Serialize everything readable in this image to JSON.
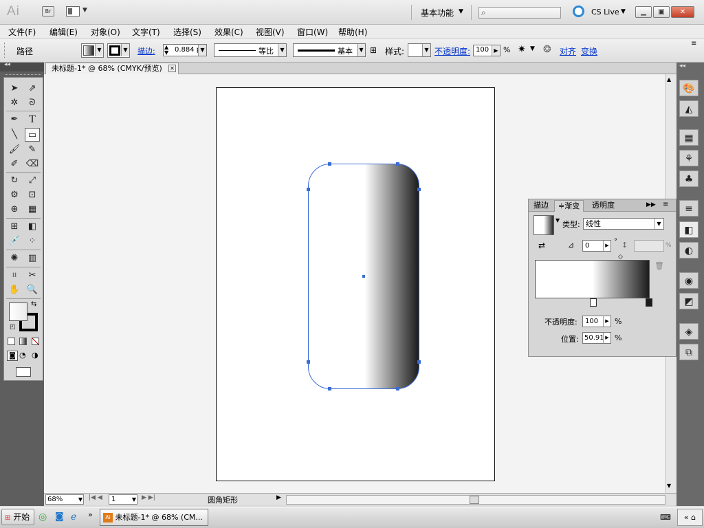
{
  "app": {
    "logo": "Ai",
    "bridge_label": "Br",
    "workspace_label": "基本功能",
    "cs_live_label": "CS Live"
  },
  "window_controls": {
    "minimize": "▁",
    "restore": "▣",
    "close": "✕"
  },
  "menu": [
    "文件(F)",
    "编辑(E)",
    "对象(O)",
    "文字(T)",
    "选择(S)",
    "效果(C)",
    "视图(V)",
    "窗口(W)",
    "帮助(H)"
  ],
  "control_bar": {
    "selection_type": "路径",
    "stroke_link": "描边:",
    "stroke_weight": "0.884 p",
    "profile_label": "等比",
    "brush_label": "基本",
    "style_label": "样式:",
    "opacity_link": "不透明度:",
    "opacity_value": "100",
    "percent": "%",
    "align_link": "对齐",
    "transform_link": "变换"
  },
  "document": {
    "tab_title": "未标题-1* @ 68% (CMYK/预览)",
    "close": "✕"
  },
  "status_bar": {
    "zoom": "68%",
    "page": "1",
    "tool_status": "圆角矩形"
  },
  "gradient_panel": {
    "tabs": [
      "描边",
      "≑渐变",
      "透明度"
    ],
    "type_label": "类型:",
    "type_value": "线性",
    "angle_value": "0",
    "degree": "°",
    "aspect_percent": "%",
    "opacity_label": "不透明度:",
    "opacity_value": "100",
    "location_label": "位置:",
    "location_value": "50.91",
    "percent": "%",
    "stops": [
      {
        "location": 50.91,
        "color": "#ffffff"
      },
      {
        "location": 100,
        "color": "#1b1b1b"
      }
    ]
  },
  "taskbar": {
    "start_label": "开始",
    "active_task": "未标题-1* @ 68% (CM..."
  },
  "colors": {
    "selection_blue": "#3b6bd6",
    "canvas_bg": "#f3f3f3",
    "tool_panel": "#5e5e5e"
  }
}
